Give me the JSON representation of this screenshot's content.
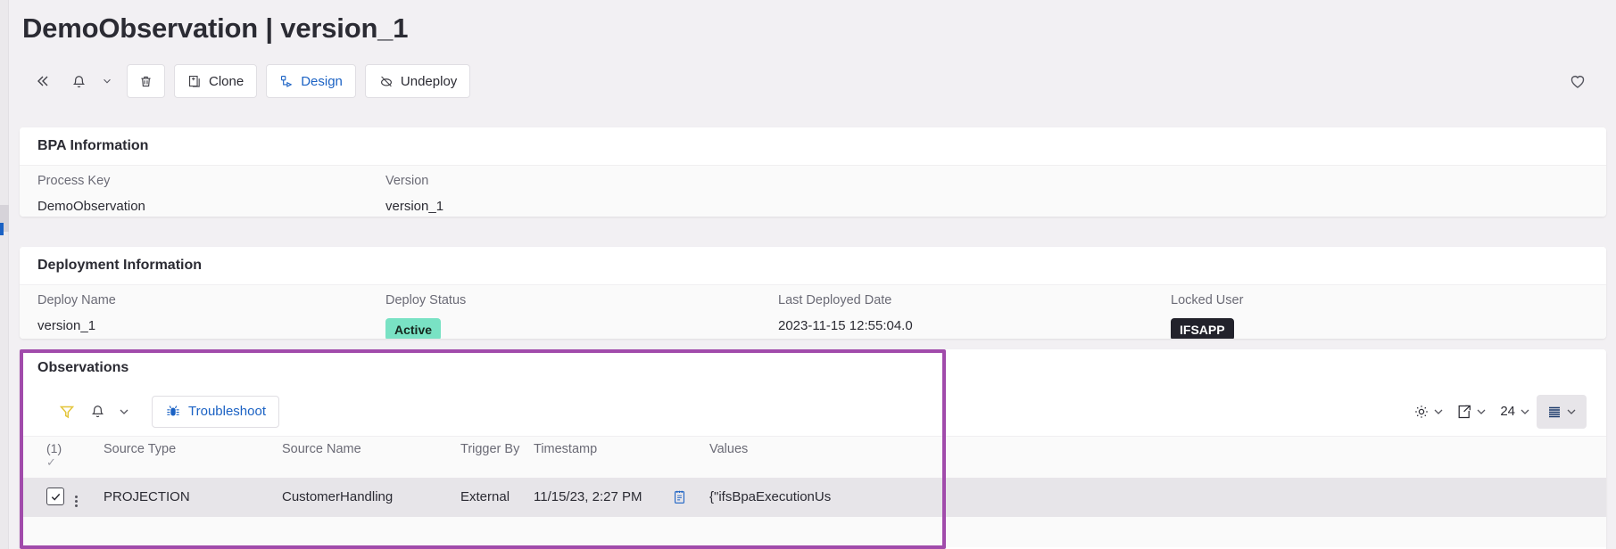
{
  "header": {
    "title": "DemoObservation | version_1",
    "favorite_icon": "heart-icon"
  },
  "toolbar": {
    "collapse_label": "«",
    "bell_icon": "bell-icon",
    "bell_chevron_icon": "chevron-down-icon",
    "delete_icon": "trash-icon",
    "clone_label": "Clone",
    "clone_icon": "clone-icon",
    "design_label": "Design",
    "design_icon": "design-icon",
    "undeploy_label": "Undeploy",
    "undeploy_icon": "undeploy-icon"
  },
  "bpa_information": {
    "title": "BPA Information",
    "fields": [
      {
        "label": "Process Key",
        "value": "DemoObservation"
      },
      {
        "label": "Version",
        "value": "version_1"
      }
    ]
  },
  "deployment_information": {
    "title": "Deployment Information",
    "fields": [
      {
        "label": "Deploy Name",
        "value": "version_1"
      },
      {
        "label": "Deploy Status",
        "value": "Active"
      },
      {
        "label": "Last Deployed Date",
        "value": "2023-11-15 12:55:04.0"
      },
      {
        "label": "Locked User",
        "value": "IFSAPP"
      }
    ]
  },
  "observations": {
    "title": "Observations",
    "toolbar": {
      "filter_icon": "filter-icon",
      "bell_icon": "bell-icon",
      "bell_chevron_icon": "chevron-down-icon",
      "troubleshoot_label": "Troubleshoot",
      "troubleshoot_icon": "bug-icon",
      "settings_icon": "gear-icon",
      "export_icon": "export-icon",
      "page_size": "24",
      "view_icon": "list-view-icon",
      "chevron_icon": "chevron-down-icon"
    },
    "table": {
      "selected_count": "(1)",
      "columns": [
        "Source Type",
        "Source Name",
        "Trigger By",
        "Timestamp",
        "Values"
      ],
      "rows": [
        {
          "selected": true,
          "source_type": "PROJECTION",
          "source_name": "CustomerHandling",
          "trigger_by": "External",
          "timestamp": "11/15/23, 2:27 PM",
          "values_icon": "clipboard-icon",
          "values": "{\"ifsBpaExecutionUs"
        }
      ]
    }
  },
  "colors": {
    "accent_blue": "#1b62c4",
    "badge_active": "#79e2c4",
    "badge_user": "#22222b",
    "annotation_purple": "#a14bab",
    "filter_yellow": "#e3c53a"
  }
}
